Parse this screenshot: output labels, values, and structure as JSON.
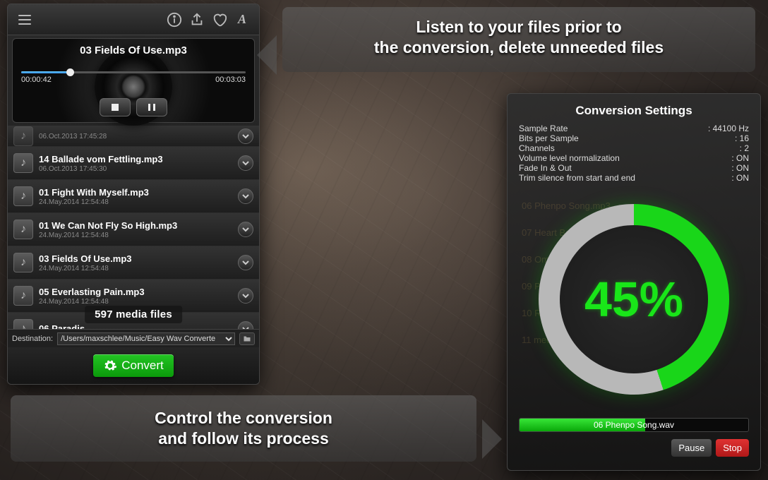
{
  "callouts": {
    "top_line1": "Listen to your files prior to",
    "top_line2": "the conversion, delete unneeded files",
    "bottom_line1": "Control the conversion",
    "bottom_line2": "and follow its process"
  },
  "player": {
    "now_playing": "03 Fields Of Use.mp3",
    "elapsed": "00:00:42",
    "total": "00:03:03"
  },
  "list": {
    "rows": [
      {
        "name": "",
        "date": "06.Oct.2013 17:45:28"
      },
      {
        "name": "14 Ballade vom Fettling.mp3",
        "date": "06.Oct.2013 17:45:30"
      },
      {
        "name": "01 Fight With Myself.mp3",
        "date": "24.May.2014 12:54:48"
      },
      {
        "name": "01 We Can Not Fly So High.mp3",
        "date": "24.May.2014 12:54:48"
      },
      {
        "name": "03 Fields Of Use.mp3",
        "date": "24.May.2014 12:54:48"
      },
      {
        "name": "05 Everlasting Pain.mp3",
        "date": "24.May.2014 12:54:48"
      },
      {
        "name": "06 Paradis",
        "date": ""
      }
    ],
    "count": "597 media files"
  },
  "destination": {
    "label": "Destination:",
    "path": "/Users/maxschlee/Music/Easy Wav Converte"
  },
  "convert_label": "Convert",
  "settings_panel": {
    "title": "Conversion Settings",
    "rows": [
      {
        "key": "Sample Rate",
        "val": "44100 Hz"
      },
      {
        "key": "Bits per Sample",
        "val": "16"
      },
      {
        "key": "Channels",
        "val": "2"
      },
      {
        "key": "Volume level normalization",
        "val": "ON"
      },
      {
        "key": "Fade In & Out",
        "val": "ON"
      },
      {
        "key": "Trim silence from start and end",
        "val": "ON"
      }
    ],
    "percent": "45%",
    "bar_file": "06 Phenpo Song.wav",
    "pause": "Pause",
    "stop": "Stop",
    "ghost_items": [
      "06 Phenpo Song.mp3",
      "07 Heart Beat Of Life.mp3",
      "08 Om.mp3",
      "09 Prince Of Tara.mp3",
      "10 Reflection Of Balance.mp3",
      "11 media files"
    ]
  }
}
